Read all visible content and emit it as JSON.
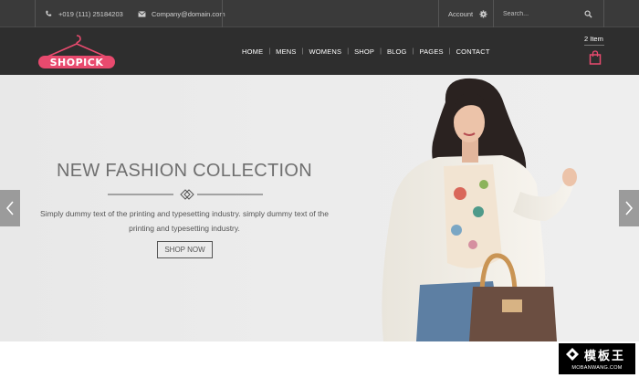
{
  "topbar": {
    "phone": "+019 (111) 25184203",
    "email": "Company@domain.com",
    "account_label": "Account",
    "search_placeholder": "Search..."
  },
  "header": {
    "logo_text": "SHOPICK",
    "nav": [
      "HOME",
      "MENS",
      "WOMENS",
      "SHOP",
      "BLOG",
      "PAGES",
      "CONTACT"
    ],
    "nav_separator": "|",
    "cart_count": "2 Item"
  },
  "hero": {
    "title": "NEW FASHION COLLECTION",
    "text": "Simply dummy text of the printing and typesetting industry. simply dummy text of the printing and typesetting industry.",
    "button_label": "SHOP NOW"
  },
  "watermark": {
    "cn": "模板王",
    "en": "MOBANWANG.COM"
  },
  "colors": {
    "topbar_bg": "#3a3a3a",
    "header_bg": "#2e2e2e",
    "brand_pink": "#e84a6e",
    "hero_bg": "#ececec"
  },
  "icons": [
    "phone-icon",
    "mail-icon",
    "gear-icon",
    "search-icon",
    "hanger-icon",
    "shopping-bag-icon",
    "chevron-left-icon",
    "chevron-right-icon"
  ]
}
